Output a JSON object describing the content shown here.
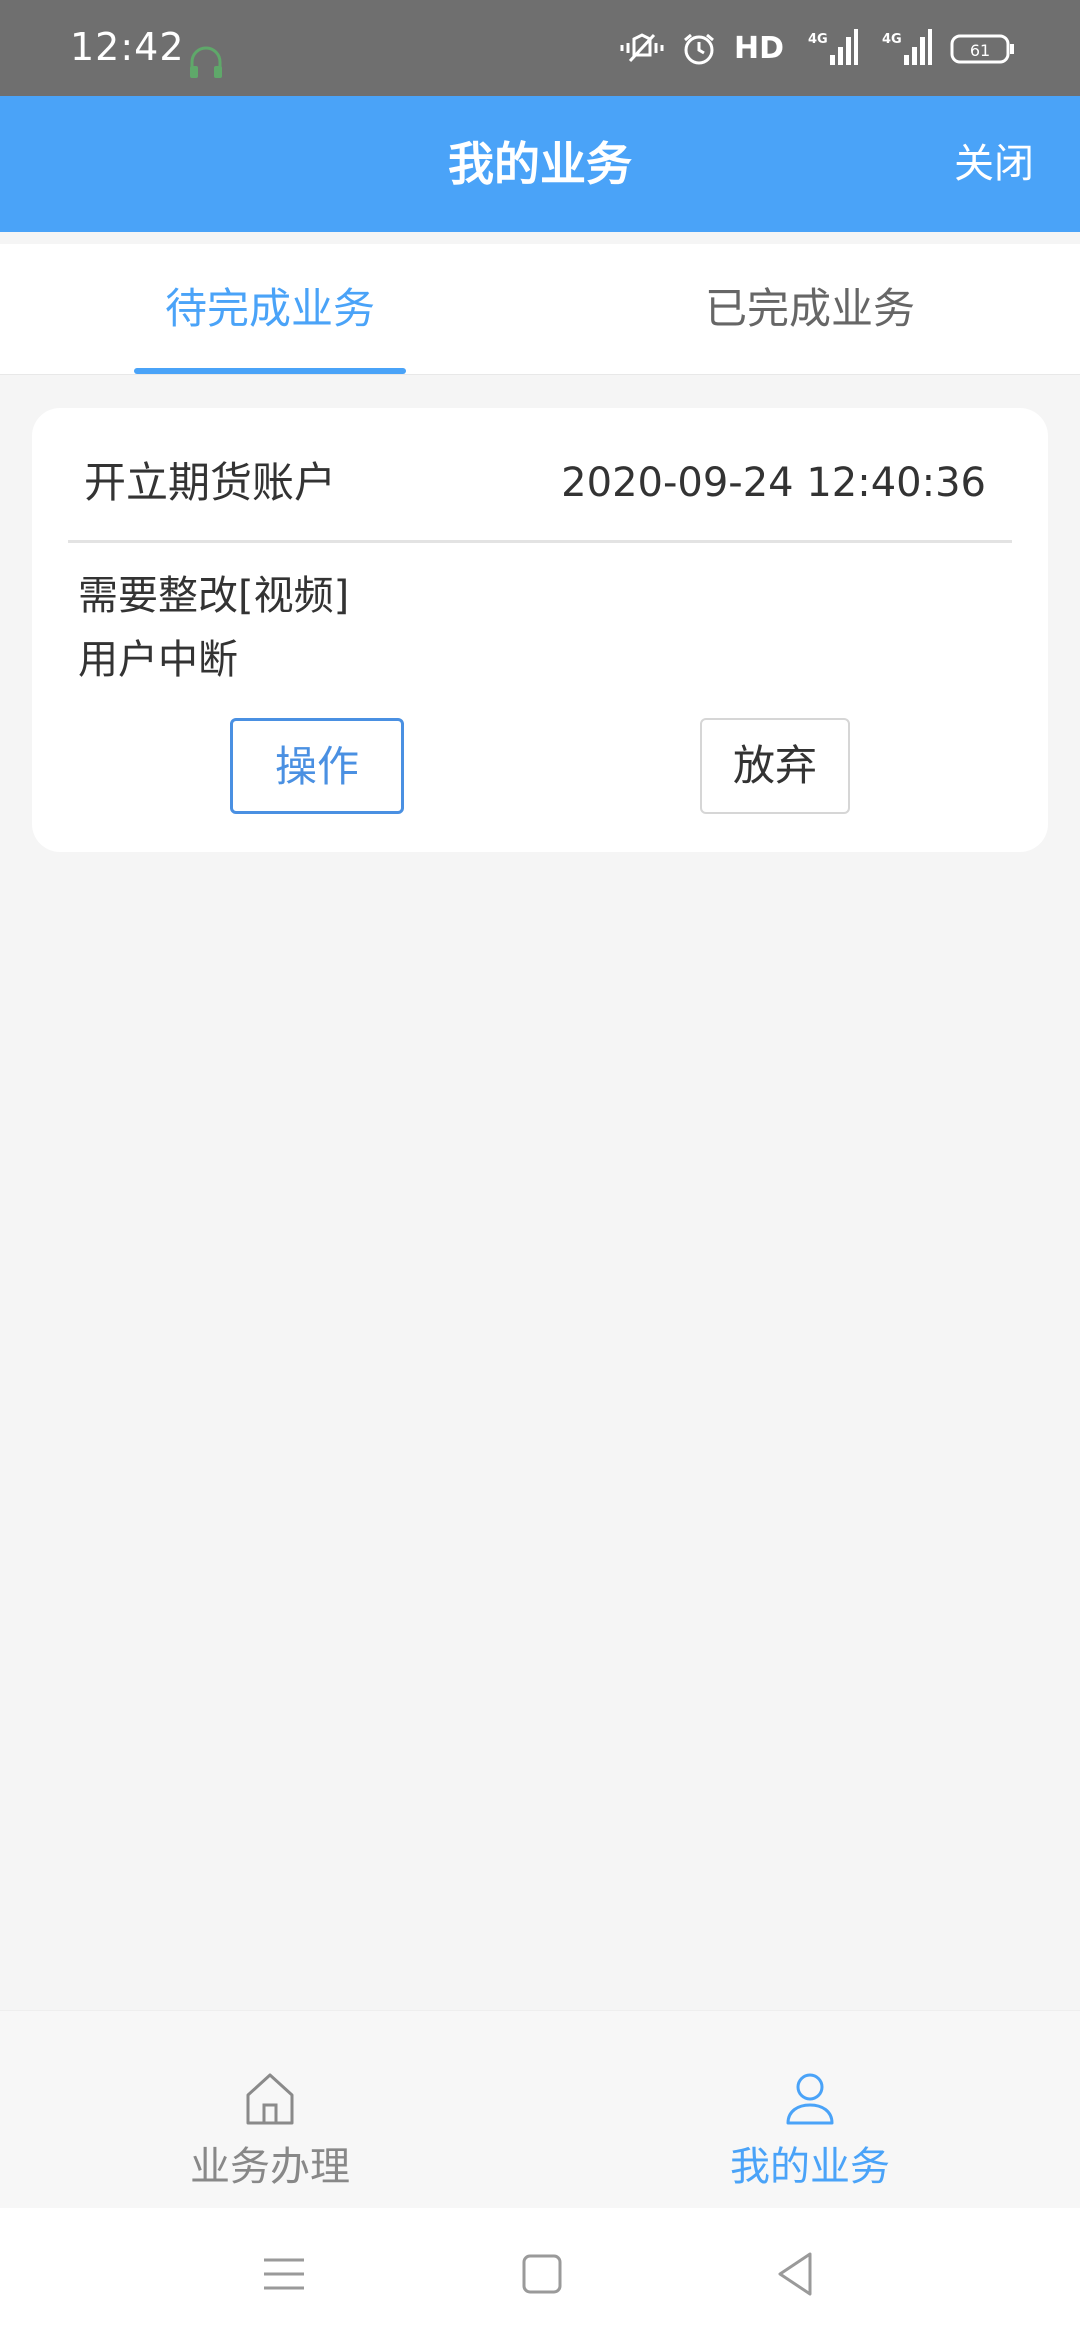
{
  "status_bar": {
    "time": "12:42",
    "hd_label": "HD",
    "network_1": "4G",
    "network_2": "4G",
    "battery": "61",
    "icons": [
      "headset-icon",
      "vibrate-icon",
      "alarm-icon",
      "signal-icon",
      "battery-icon"
    ]
  },
  "header": {
    "title": "我的业务",
    "close_label": "关闭",
    "bg_color": "#4aa3f8"
  },
  "tabs": [
    {
      "label": "待完成业务",
      "active": true
    },
    {
      "label": "已完成业务",
      "active": false
    }
  ],
  "card": {
    "title": "开立期货账户",
    "time": "2020-09-24 12:40:36",
    "status": "需要整改[视频]",
    "reason": "用户中断",
    "operate_label": "操作",
    "abandon_label": "放弃"
  },
  "bottom_nav": [
    {
      "label": "业务办理",
      "icon": "home-icon",
      "active": false
    },
    {
      "label": "我的业务",
      "icon": "user-icon",
      "active": true
    }
  ],
  "system_nav": [
    "menu-icon",
    "home-square-icon",
    "back-triangle-icon"
  ],
  "colors": {
    "accent": "#4aa3f8",
    "operate_border": "#4a90e2",
    "text": "#333333",
    "background": "#f5f5f5"
  }
}
